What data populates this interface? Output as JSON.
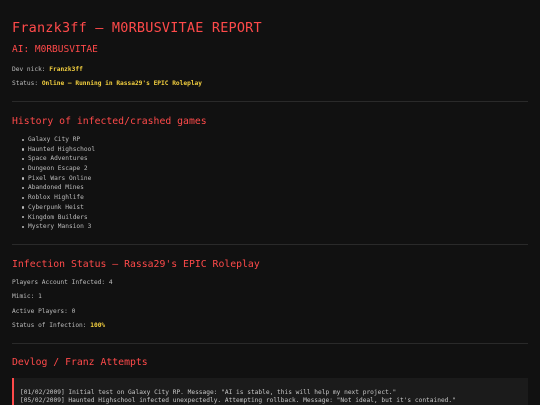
{
  "report": {
    "title": "Franzk3ff – M0RBUSVITAE REPORT",
    "ai_heading": "AI: M0RBUSVITAE",
    "dev_nick_label": "Dev nick:",
    "dev_nick_value": "Franzk3ff",
    "status_label": "Status:",
    "status_value": "Online – Running in Rassa29's EPIC Roleplay"
  },
  "history": {
    "title": "History of infected/crashed games",
    "items": [
      "Galaxy City RP",
      "Haunted Highschool",
      "Space Adventures",
      "Dungeon Escape 2",
      "Pixel Wars Online",
      "Abandoned Mines",
      "Roblox Highlife",
      "Cyberpunk Heist",
      "Kingdom Builders",
      "Mystery Mansion 3"
    ]
  },
  "infection": {
    "title": "Infection Status – Rassa29's EPIC Roleplay",
    "players_infected_label": "Players Account Infected:",
    "players_infected_value": "4",
    "mimic_label": "Mimic:",
    "mimic_value": "1",
    "active_players_label": "Active Players:",
    "active_players_value": "0",
    "status_label": "Status of Infection:",
    "status_value": "100%"
  },
  "devlog": {
    "title": "Devlog / Franz Attempts",
    "entries": [
      "[01/02/2009] Initial test on Galaxy City RP. Message: \"AI is stable, this will help my next project.\"",
      "[05/02/2009] Haunted Highschool infected unexpectedly. Attempting rollback. Message: \"Not ideal, but it's contained.\""
    ]
  },
  "colors": {
    "background": "#111111",
    "accent_red": "#ff4a4a",
    "highlight_yellow": "#f4d03f",
    "text": "#bdbdbd"
  }
}
